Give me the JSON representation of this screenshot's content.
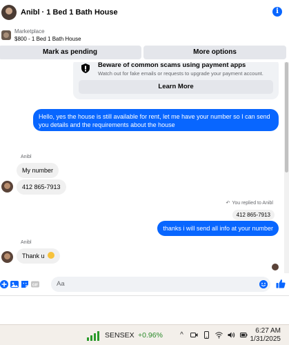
{
  "header": {
    "title": "Anibl · 1 Bed 1 Bath House"
  },
  "marketplace": {
    "label": "Marketplace",
    "item": "$800 - 1 Bed 1 Bath House"
  },
  "actions": {
    "pending": "Mark as pending",
    "more": "More options"
  },
  "warning": {
    "title": "Beware of common scams using payment apps",
    "body": "Watch out for fake emails or requests to upgrade your payment account.",
    "button": "Learn More"
  },
  "messages": {
    "m1": "Hello, yes the house is still available for rent, let me have your number so I can send you details and the requirements about the house",
    "sender1": "Anibl",
    "m2": "My number",
    "m3": "412 865-7913",
    "replied": "You replied to Anibl",
    "quoted": "412 865-7913",
    "m4": "thanks i will send all info at your number",
    "sender2": "Anibl",
    "m5": "Thank u"
  },
  "composer": {
    "placeholder": "Aa"
  },
  "taskbar": {
    "sensex_label": "SENSEX",
    "sensex_change": "+0.96%",
    "time": "6:27 AM",
    "date": "1/31/2025"
  },
  "colors": {
    "accent": "#0866ff",
    "positive": "#2a8a2a"
  },
  "icons": [
    "info-icon",
    "shield-icon",
    "plus-icon",
    "image-icon",
    "sticker-icon",
    "gif-icon",
    "emoji-icon",
    "like-icon",
    "sensex-chart-icon",
    "chevron-up-icon",
    "video-icon",
    "phone-icon",
    "wifi-icon",
    "volume-icon",
    "battery-icon"
  ]
}
